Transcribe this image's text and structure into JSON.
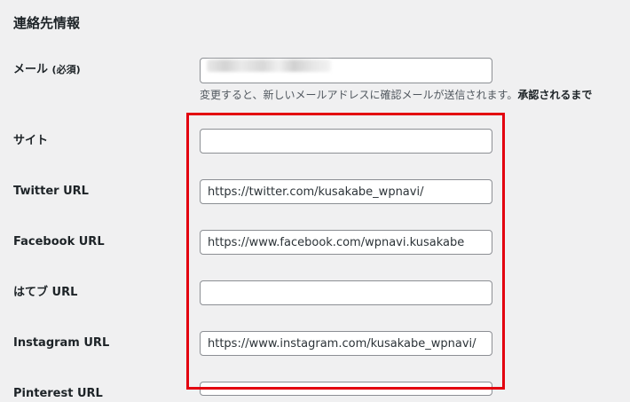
{
  "section": {
    "title": "連絡先情報"
  },
  "email": {
    "label": "メール",
    "required": "(必須)",
    "description": "変更すると、新しいメールアドレスに確認メールが送信されます。",
    "description_bold": "承認されるまで"
  },
  "fields": {
    "site": {
      "label": "サイト",
      "value": ""
    },
    "twitter": {
      "label": "Twitter URL",
      "value": "https://twitter.com/kusakabe_wpnavi/"
    },
    "facebook": {
      "label": "Facebook URL",
      "value": "https://www.facebook.com/wpnavi.kusakabe"
    },
    "hatena": {
      "label": "はてブ URL",
      "value": ""
    },
    "instagram": {
      "label": "Instagram URL",
      "value": "https://www.instagram.com/kusakabe_wpnavi/"
    },
    "pinterest": {
      "label": "Pinterest URL",
      "value": ""
    }
  },
  "colors": {
    "highlight": "#e3000f",
    "background": "#f0f0f1",
    "input_border": "#8c8f94"
  }
}
